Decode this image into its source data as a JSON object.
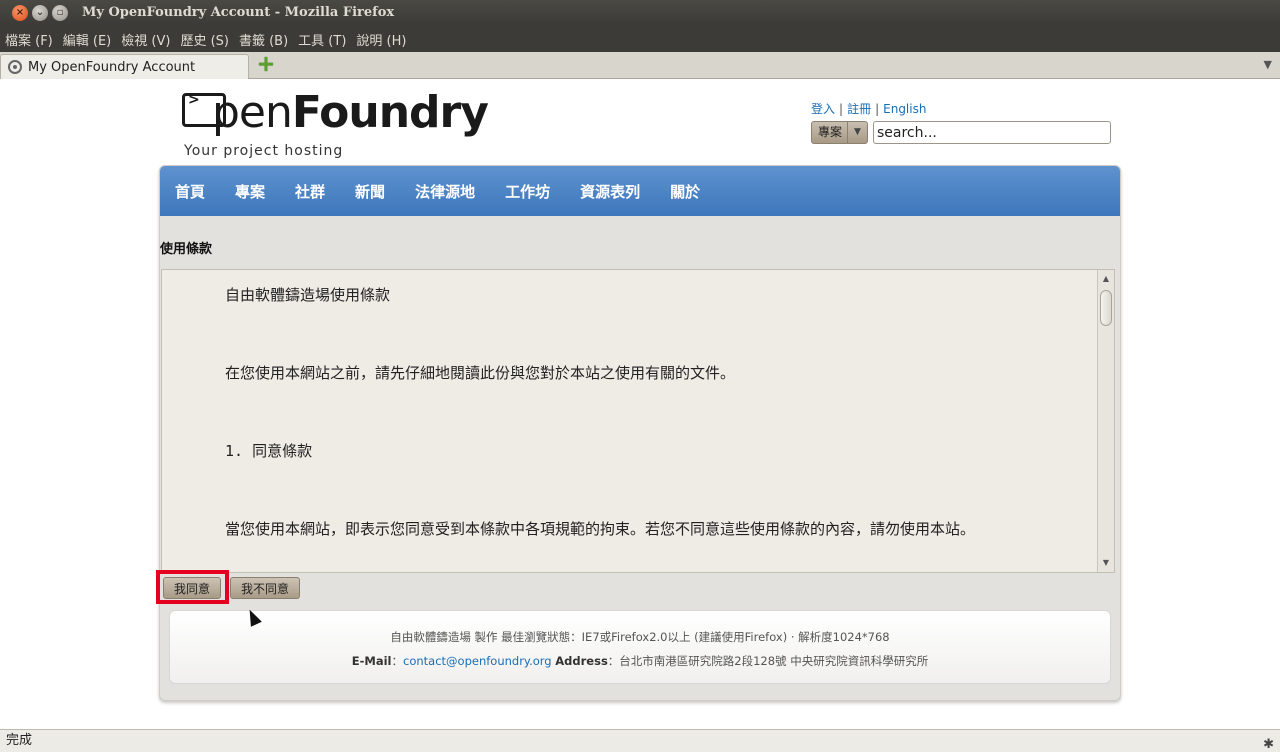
{
  "window": {
    "title": "My OpenFoundry Account - Mozilla Firefox"
  },
  "menu": [
    "檔案 (F)",
    "編輯 (E)",
    "檢視 (V)",
    "歷史 (S)",
    "書籤 (B)",
    "工具 (T)",
    "說明 (H)"
  ],
  "tab": {
    "label": "My OpenFoundry Account",
    "new_tab": "+",
    "list_arrow": "▼"
  },
  "site": {
    "logo_open": "pen",
    "logo_foundry": "Foundry",
    "tagline": "Your project hosting",
    "links": [
      "登入",
      "註冊",
      "English"
    ],
    "link_sep": "|",
    "search_scope": "專案",
    "search_value": "search..."
  },
  "nav": [
    "首頁",
    "專案",
    "社群",
    "新聞",
    "法律源地",
    "工作坊",
    "資源表列",
    "關於"
  ],
  "page_heading": "使用條款",
  "terms": {
    "title": "自由軟體鑄造場使用條款",
    "intro": "在您使用本網站之前，請先仔細地閱讀此份與您對於本站之使用有關的文件。",
    "section1": "1. 同意條款",
    "section1_body": "當您使用本網站，即表示您同意受到本條款中各項規範的拘束。若您不同意這些使用條款的內容，請勿使用本站。"
  },
  "buttons": {
    "agree": "我同意",
    "disagree": "我不同意"
  },
  "footer": {
    "line1": "自由軟體鑄造場 製作 最佳瀏覽狀態：IE7或Firefox2.0以上 (建議使用Firefox) · 解析度1024*768",
    "email_label": "E-Mail",
    "email": "contact@openfoundry.org",
    "address_label": "Address",
    "address": "：台北市南港區研究院路2段128號 中央研究院資訊科學研究所"
  },
  "status": {
    "text": "完成"
  }
}
